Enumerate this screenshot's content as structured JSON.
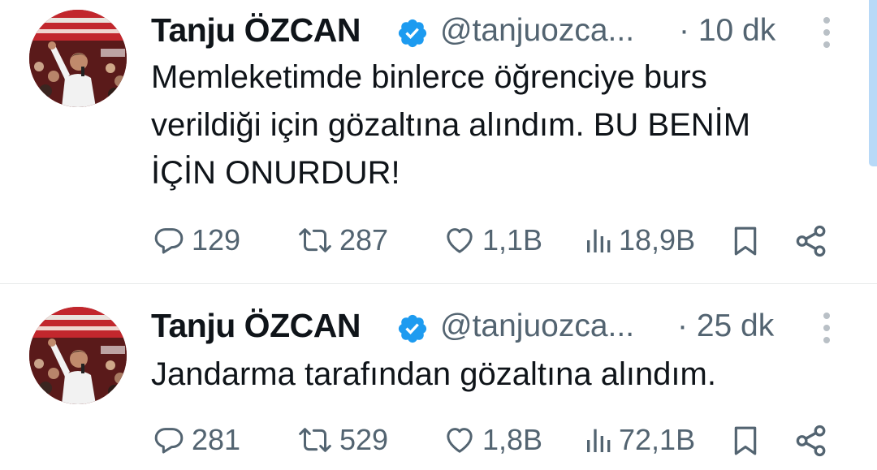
{
  "colors": {
    "text": "#0f1419",
    "secondary": "#536471",
    "verified": "#1d9bf0",
    "divider": "#e7e9ea"
  },
  "tweets": [
    {
      "author_name": "Tanju ÖZCAN",
      "handle": "@tanjuozca...",
      "time": "· 10 dk",
      "text": "Memleketimde binlerce öğrenciye burs\nverildiği için gözaltına alındım. BU BENİM\nİÇİN ONURDUR!",
      "replies": "129",
      "retweets": "287",
      "likes": "1,1B",
      "views": "18,9B"
    },
    {
      "author_name": "Tanju ÖZCAN",
      "handle": "@tanjuozca...",
      "time": "· 25 dk",
      "text": "Jandarma tarafından gözaltına alındım.",
      "replies": "281",
      "retweets": "529",
      "likes": "1,8B",
      "views": "72,1B"
    }
  ],
  "icons": {
    "verified": "verified-badge-icon",
    "more": "more-vertical-icon",
    "reply": "reply-bubble-icon",
    "retweet": "retweet-icon",
    "like": "heart-icon",
    "views": "views-bar-chart-icon",
    "bookmark": "bookmark-icon",
    "share": "share-icon"
  }
}
